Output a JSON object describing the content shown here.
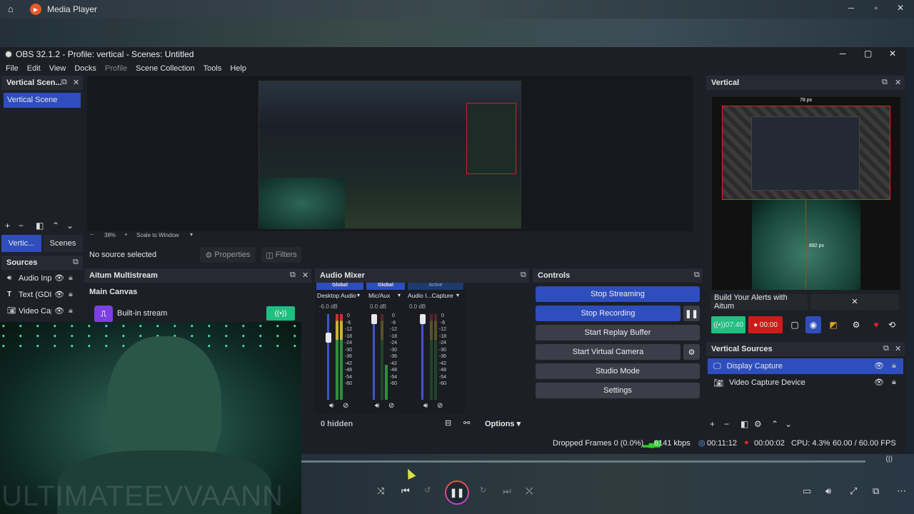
{
  "media_player": {
    "title": "Media Player",
    "controls": {
      "play_state": "pause-icon"
    }
  },
  "obs": {
    "title": "OBS 32.1.2 - Profile: vertical - Scenes: Untitled",
    "menu": [
      "File",
      "Edit",
      "View",
      "Docks",
      "Profile",
      "Scene Collection",
      "Tools",
      "Help"
    ],
    "scenes_dock": {
      "title": "Vertical Scen...",
      "items": [
        "Vertical Scene"
      ],
      "tabs": [
        "Vertic...",
        "Scenes"
      ]
    },
    "sources_dock": {
      "title": "Sources",
      "items": [
        {
          "label": "Audio Inp",
          "icon": "speaker-icon"
        },
        {
          "label": "Text (GDI+",
          "icon": "text-icon"
        },
        {
          "label": "Video Cap",
          "icon": "camera-icon"
        }
      ]
    },
    "preview": {
      "zoom": "38%",
      "scale": "Scale to Window"
    },
    "source_bar": {
      "no_source": "No source selected",
      "properties": "Properties",
      "filters": "Filters"
    },
    "aitum": {
      "title": "Aitum Multistream",
      "canvas": "Main Canvas",
      "stream": "Built-in stream"
    },
    "mixer": {
      "title": "Audio Mixer",
      "channels": [
        {
          "tag": "Global",
          "name": "Desktop Audio",
          "db": "-6.0 dB",
          "level": 0.7
        },
        {
          "tag": "Global",
          "name": "Mic/Aux",
          "db": "0.0 dB",
          "level": 0.4
        },
        {
          "tag": "Active",
          "name": "Audio I...Capture",
          "db": "0.0 dB",
          "level": 0.0
        }
      ],
      "scale": [
        "0",
        "-6",
        "-12",
        "-18",
        "-24",
        "-30",
        "-36",
        "-42",
        "-48",
        "-54",
        "-60"
      ],
      "hidden": "0 hidden",
      "options": "Options"
    },
    "controls": {
      "title": "Controls",
      "stop_streaming": "Stop Streaming",
      "stop_recording": "Stop Recording",
      "replay": "Start Replay Buffer",
      "virtual_cam": "Start Virtual Camera",
      "studio_mode": "Studio Mode",
      "settings": "Settings"
    },
    "vertical": {
      "title": "Vertical",
      "dim_top": "78 px",
      "dim_side": "892 px",
      "alert": "Build Your Alerts with Aitum",
      "stream_time": "07:40",
      "rec_time": "00:00"
    },
    "vertical_sources": {
      "title": "Vertical Sources",
      "items": [
        {
          "label": "Display Capture",
          "icon": "monitor-icon"
        },
        {
          "label": "Video Capture Device",
          "icon": "camera-icon"
        }
      ]
    },
    "status": {
      "dropped": "Dropped Frames 0 (0.0%)",
      "kbps": "6141 kbps",
      "stream_time": "00:11:12",
      "rec_time": "00:00:02",
      "cpu": "CPU: 4.3%",
      "fps": "60.00 / 60.00 FPS"
    }
  },
  "overlay": {
    "watermark": "ULTIMATEEVVAANN"
  },
  "colors": {
    "accent": "#2e4ebd",
    "stream_green": "#1fbf80",
    "rec_red": "#d01a1a"
  }
}
